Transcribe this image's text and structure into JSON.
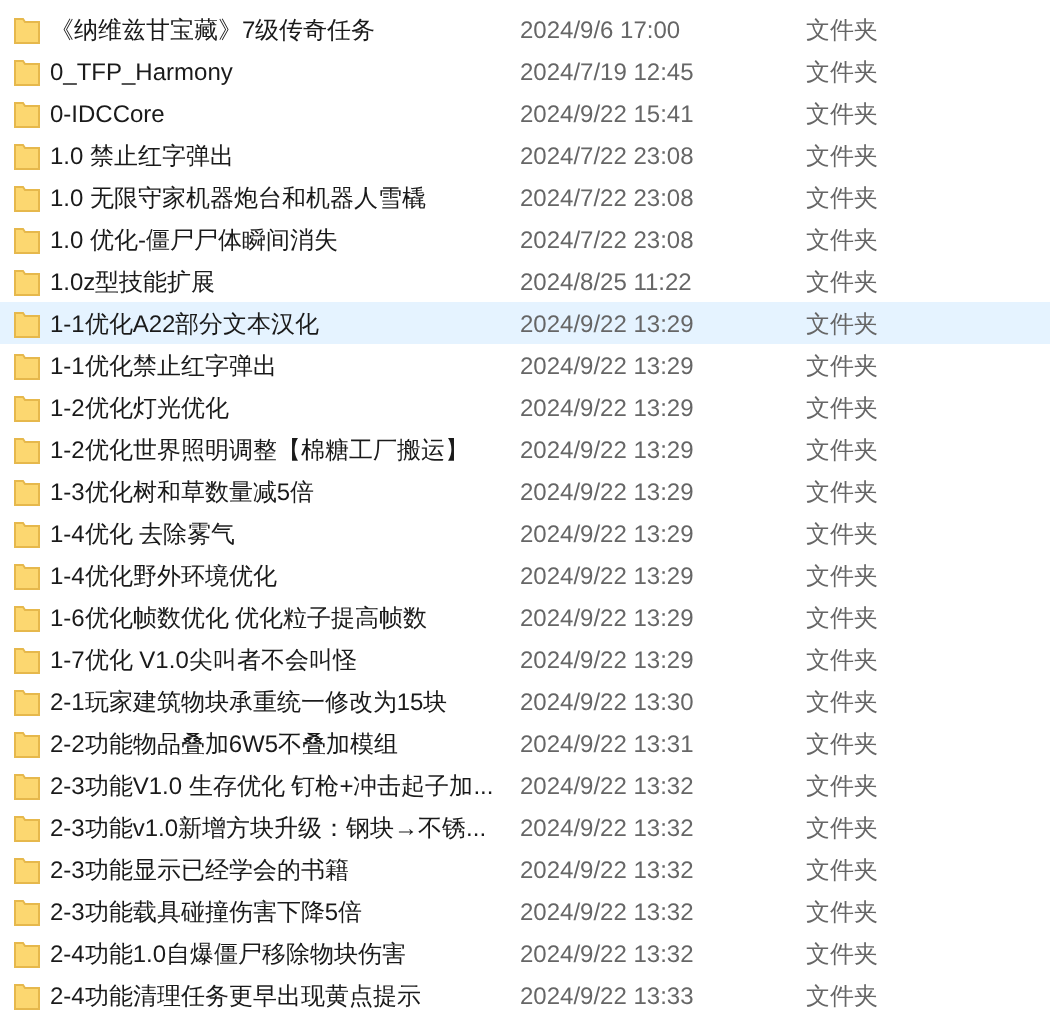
{
  "files": [
    {
      "name": "《纳维兹甘宝藏》7级传奇任务",
      "modified": "2024/9/6 17:00",
      "type": "文件夹",
      "selected": false
    },
    {
      "name": "0_TFP_Harmony",
      "modified": "2024/7/19 12:45",
      "type": "文件夹",
      "selected": false
    },
    {
      "name": "0-IDCCore",
      "modified": "2024/9/22 15:41",
      "type": "文件夹",
      "selected": false
    },
    {
      "name": "1.0 禁止红字弹出",
      "modified": "2024/7/22 23:08",
      "type": "文件夹",
      "selected": false
    },
    {
      "name": "1.0 无限守家机器炮台和机器人雪橇",
      "modified": "2024/7/22 23:08",
      "type": "文件夹",
      "selected": false
    },
    {
      "name": "1.0 优化-僵尸尸体瞬间消失",
      "modified": "2024/7/22 23:08",
      "type": "文件夹",
      "selected": false
    },
    {
      "name": "1.0z型技能扩展",
      "modified": "2024/8/25 11:22",
      "type": "文件夹",
      "selected": false
    },
    {
      "name": "1-1优化A22部分文本汉化",
      "modified": "2024/9/22 13:29",
      "type": "文件夹",
      "selected": true
    },
    {
      "name": "1-1优化禁止红字弹出",
      "modified": "2024/9/22 13:29",
      "type": "文件夹",
      "selected": false
    },
    {
      "name": "1-2优化灯光优化",
      "modified": "2024/9/22 13:29",
      "type": "文件夹",
      "selected": false
    },
    {
      "name": "1-2优化世界照明调整【棉糖工厂搬运】",
      "modified": "2024/9/22 13:29",
      "type": "文件夹",
      "selected": false
    },
    {
      "name": "1-3优化树和草数量减5倍",
      "modified": "2024/9/22 13:29",
      "type": "文件夹",
      "selected": false
    },
    {
      "name": "1-4优化 去除雾气",
      "modified": "2024/9/22 13:29",
      "type": "文件夹",
      "selected": false
    },
    {
      "name": "1-4优化野外环境优化",
      "modified": "2024/9/22 13:29",
      "type": "文件夹",
      "selected": false
    },
    {
      "name": "1-6优化帧数优化 优化粒子提高帧数",
      "modified": "2024/9/22 13:29",
      "type": "文件夹",
      "selected": false
    },
    {
      "name": "1-7优化 V1.0尖叫者不会叫怪",
      "modified": "2024/9/22 13:29",
      "type": "文件夹",
      "selected": false
    },
    {
      "name": "2-1玩家建筑物块承重统一修改为15块",
      "modified": "2024/9/22 13:30",
      "type": "文件夹",
      "selected": false
    },
    {
      "name": "2-2功能物品叠加6W5不叠加模组",
      "modified": "2024/9/22 13:31",
      "type": "文件夹",
      "selected": false
    },
    {
      "name": "2-3功能V1.0 生存优化 钉枪+冲击起子加...",
      "modified": "2024/9/22 13:32",
      "type": "文件夹",
      "selected": false
    },
    {
      "name": "2-3功能v1.0新增方块升级：钢块→不锈...",
      "modified": "2024/9/22 13:32",
      "type": "文件夹",
      "selected": false
    },
    {
      "name": "2-3功能显示已经学会的书籍",
      "modified": "2024/9/22 13:32",
      "type": "文件夹",
      "selected": false
    },
    {
      "name": "2-3功能载具碰撞伤害下降5倍",
      "modified": "2024/9/22 13:32",
      "type": "文件夹",
      "selected": false
    },
    {
      "name": "2-4功能1.0自爆僵尸移除物块伤害",
      "modified": "2024/9/22 13:32",
      "type": "文件夹",
      "selected": false
    },
    {
      "name": "2-4功能清理任务更早出现黄点提示",
      "modified": "2024/9/22 13:33",
      "type": "文件夹",
      "selected": false
    }
  ]
}
